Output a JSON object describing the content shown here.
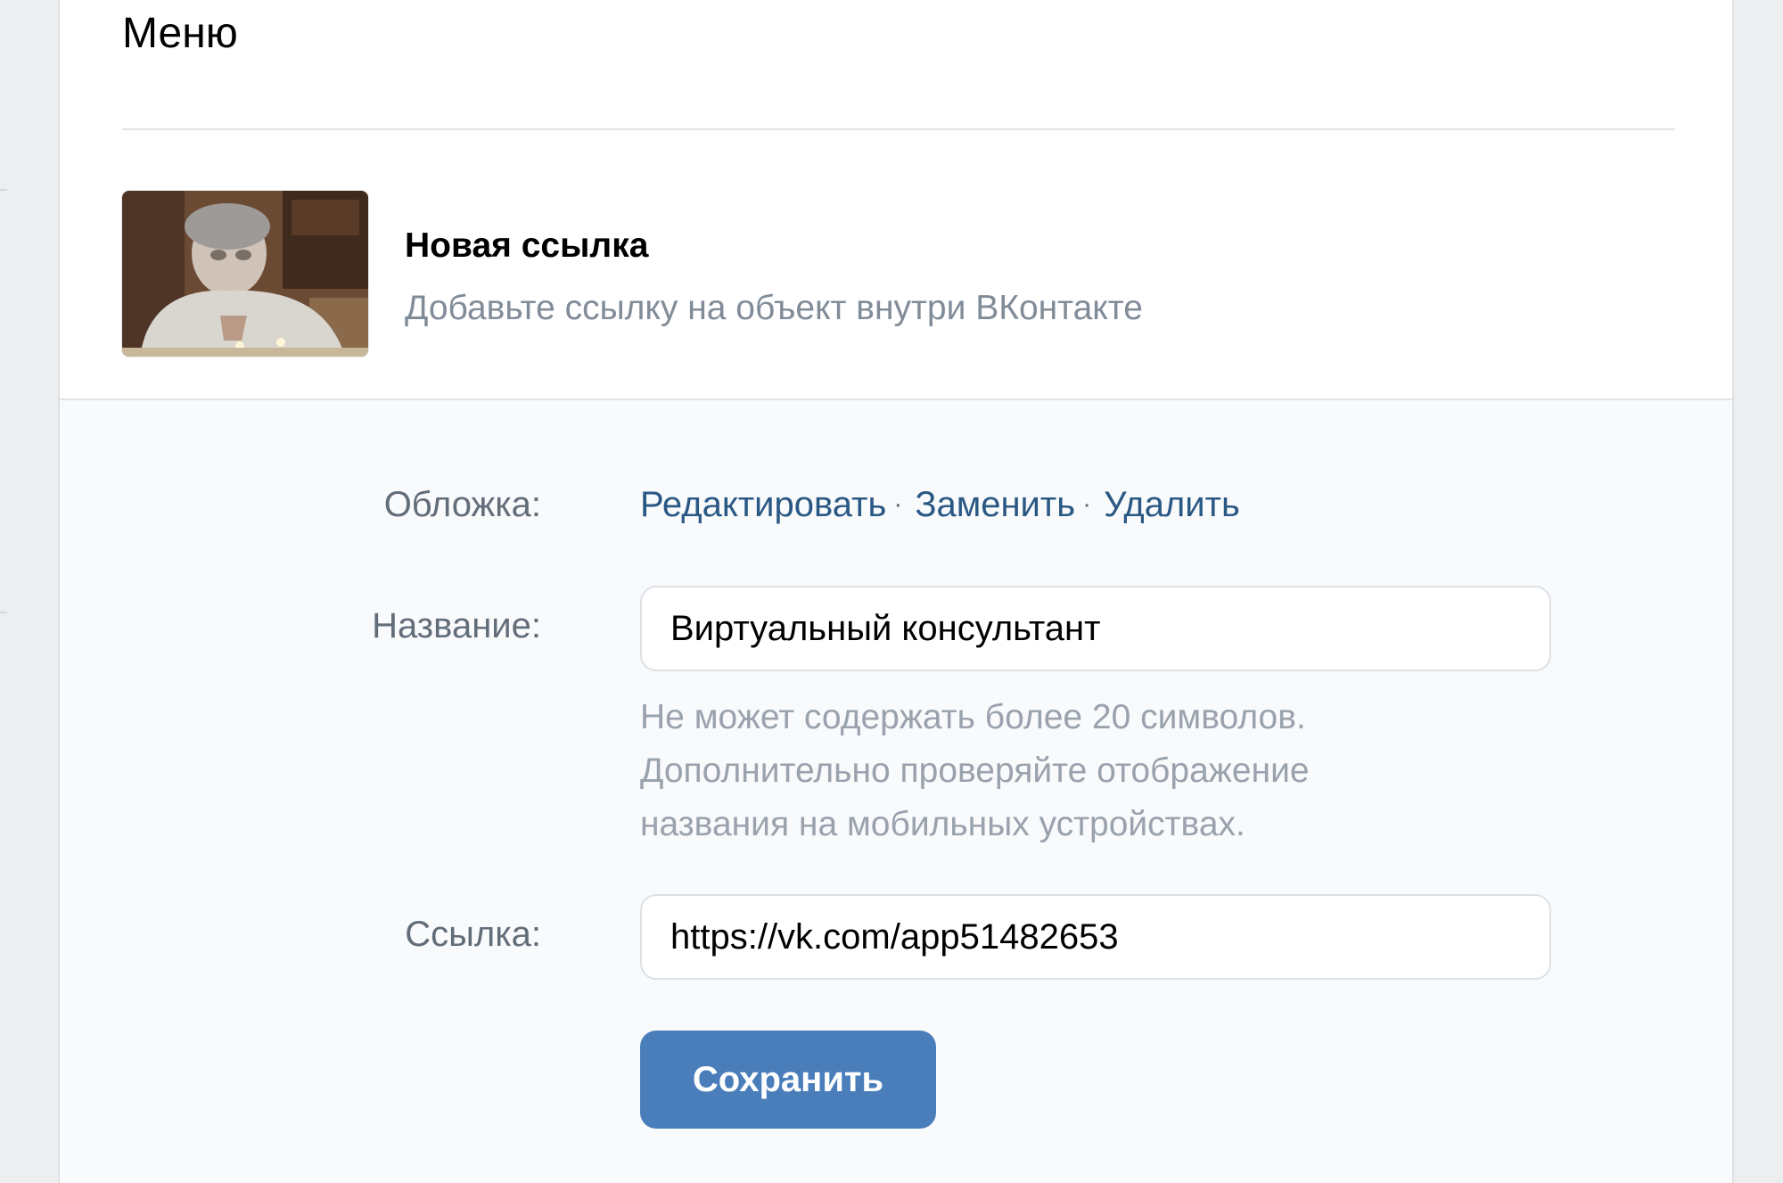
{
  "header": {
    "title": "Меню"
  },
  "link_item": {
    "thumbnail_icon": "photo-thumbnail",
    "title": "Новая ссылка",
    "description": "Добавьте ссылку на объект внутри ВКонтакте"
  },
  "form": {
    "cover_label": "Обложка:",
    "cover_actions": {
      "edit": "Редактировать",
      "replace": "Заменить",
      "delete": "Удалить",
      "separator": "·"
    },
    "name_label": "Название:",
    "name_value": "Виртуальный консультант",
    "name_hint_lines": [
      "Не может содержать более 20 символов.",
      "Дополнительно проверяйте отображение",
      "названия на мобильных устройствах."
    ],
    "link_label": "Ссылка:",
    "link_value": "https://vk.com/app51482653",
    "save_label": "Сохранить"
  },
  "colors": {
    "page_background": "#edeef0",
    "form_background": "#f9fafb",
    "link": "#2a5885",
    "button": "#4a7ebb",
    "muted_text": "#818c99"
  }
}
